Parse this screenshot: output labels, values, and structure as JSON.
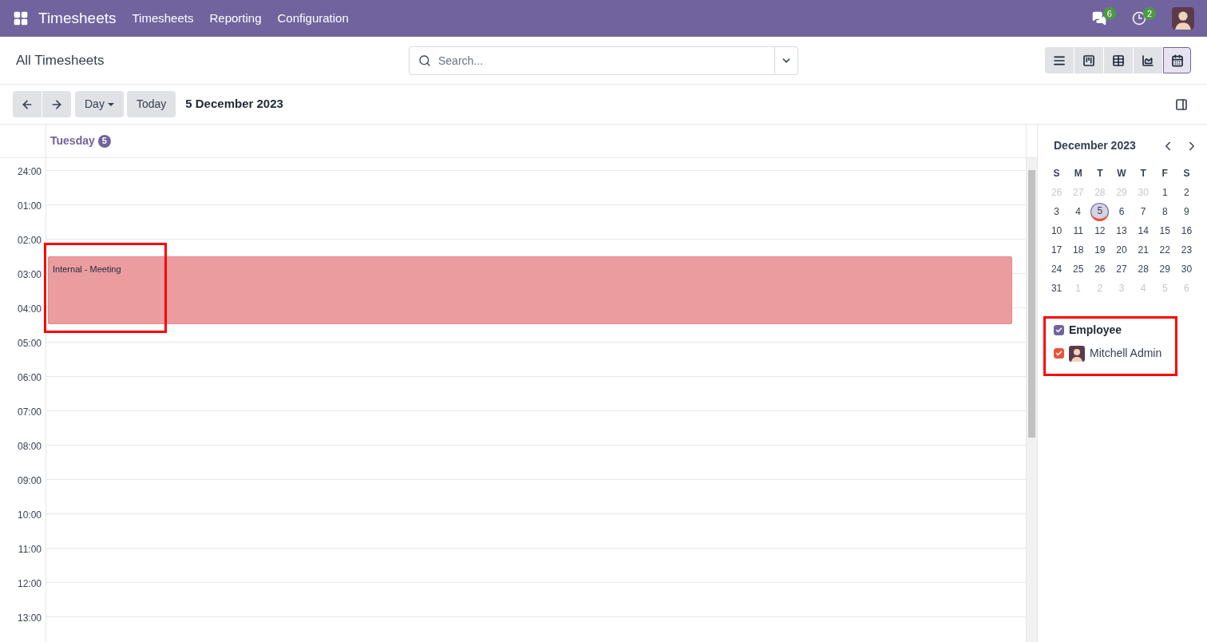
{
  "navbar": {
    "app_name": "Timesheets",
    "menu": [
      "Timesheets",
      "Reporting",
      "Configuration"
    ],
    "systray": [
      {
        "kind": "messages",
        "count": "6"
      },
      {
        "kind": "activities",
        "count": "2"
      }
    ]
  },
  "control_panel": {
    "title": "All Timesheets",
    "search": {
      "placeholder": "Search..."
    },
    "views": [
      {
        "kind": "list",
        "selected": false
      },
      {
        "kind": "kanban",
        "selected": false
      },
      {
        "kind": "pivot",
        "selected": false
      },
      {
        "kind": "graph",
        "selected": false
      },
      {
        "kind": "calendar",
        "selected": true
      }
    ]
  },
  "toolbar": {
    "scale": "Day",
    "today": "Today",
    "date": "5 December 2023"
  },
  "day_header": {
    "day": "Tuesday",
    "number": "5"
  },
  "hours": [
    "24:00",
    "01:00",
    "02:00",
    "03:00",
    "04:00",
    "05:00",
    "06:00",
    "07:00",
    "08:00",
    "09:00",
    "10:00",
    "11:00",
    "12:00",
    "13:00"
  ],
  "events": [
    {
      "title": "Internal - Meeting"
    }
  ],
  "mini_calendar": {
    "title": "December 2023",
    "weekdays": [
      "S",
      "M",
      "T",
      "W",
      "T",
      "F",
      "S"
    ],
    "weeks": [
      [
        {
          "d": "26",
          "outside": true,
          "selected": false
        },
        {
          "d": "27",
          "outside": true,
          "selected": false
        },
        {
          "d": "28",
          "outside": true,
          "selected": false
        },
        {
          "d": "29",
          "outside": true,
          "selected": false
        },
        {
          "d": "30",
          "outside": true,
          "selected": false
        },
        {
          "d": "1",
          "outside": false,
          "selected": false
        },
        {
          "d": "2",
          "outside": false,
          "selected": false
        }
      ],
      [
        {
          "d": "3",
          "outside": false,
          "selected": false
        },
        {
          "d": "4",
          "outside": false,
          "selected": false
        },
        {
          "d": "5",
          "outside": false,
          "selected": true
        },
        {
          "d": "6",
          "outside": false,
          "selected": false
        },
        {
          "d": "7",
          "outside": false,
          "selected": false
        },
        {
          "d": "8",
          "outside": false,
          "selected": false
        },
        {
          "d": "9",
          "outside": false,
          "selected": false
        }
      ],
      [
        {
          "d": "10",
          "outside": false,
          "selected": false
        },
        {
          "d": "11",
          "outside": false,
          "selected": false
        },
        {
          "d": "12",
          "outside": false,
          "selected": false
        },
        {
          "d": "13",
          "outside": false,
          "selected": false
        },
        {
          "d": "14",
          "outside": false,
          "selected": false
        },
        {
          "d": "15",
          "outside": false,
          "selected": false
        },
        {
          "d": "16",
          "outside": false,
          "selected": false
        }
      ],
      [
        {
          "d": "17",
          "outside": false,
          "selected": false
        },
        {
          "d": "18",
          "outside": false,
          "selected": false
        },
        {
          "d": "19",
          "outside": false,
          "selected": false
        },
        {
          "d": "20",
          "outside": false,
          "selected": false
        },
        {
          "d": "21",
          "outside": false,
          "selected": false
        },
        {
          "d": "22",
          "outside": false,
          "selected": false
        },
        {
          "d": "23",
          "outside": false,
          "selected": false
        }
      ],
      [
        {
          "d": "24",
          "outside": false,
          "selected": false
        },
        {
          "d": "25",
          "outside": false,
          "selected": false
        },
        {
          "d": "26",
          "outside": false,
          "selected": false
        },
        {
          "d": "27",
          "outside": false,
          "selected": false
        },
        {
          "d": "28",
          "outside": false,
          "selected": false
        },
        {
          "d": "29",
          "outside": false,
          "selected": false
        },
        {
          "d": "30",
          "outside": false,
          "selected": false
        }
      ],
      [
        {
          "d": "31",
          "outside": false,
          "selected": false
        },
        {
          "d": "1",
          "outside": true,
          "selected": false
        },
        {
          "d": "2",
          "outside": true,
          "selected": false
        },
        {
          "d": "3",
          "outside": true,
          "selected": false
        },
        {
          "d": "4",
          "outside": true,
          "selected": false
        },
        {
          "d": "5",
          "outside": true,
          "selected": false
        },
        {
          "d": "6",
          "outside": true,
          "selected": false
        }
      ]
    ]
  },
  "filters": [
    {
      "kind": "section",
      "label": "Employee",
      "checked": true,
      "color": "#71639e"
    },
    {
      "kind": "person",
      "label": "Mitchell Admin",
      "checked": true,
      "color": "#e8553c"
    }
  ]
}
